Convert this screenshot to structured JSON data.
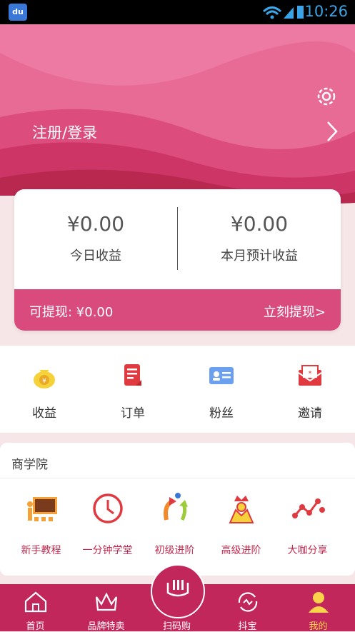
{
  "status_bar": {
    "time": "10:26",
    "app_icon_text": "du"
  },
  "header": {
    "login_label": "注册/登录"
  },
  "earnings": {
    "today_value": "¥0.00",
    "today_label": "今日收益",
    "month_value": "¥0.00",
    "month_label": "本月预计收益",
    "withdrawable_label": "可提现: ¥0.00",
    "withdraw_action": "立刻提现>"
  },
  "quick_menu": [
    {
      "label": "收益",
      "icon": "money-bag-icon"
    },
    {
      "label": "订单",
      "icon": "order-list-icon"
    },
    {
      "label": "粉丝",
      "icon": "fans-card-icon"
    },
    {
      "label": "邀请",
      "icon": "invite-envelope-icon"
    }
  ],
  "school": {
    "title": "商学院",
    "items": [
      {
        "label": "新手教程",
        "icon": "teacher-board-icon"
      },
      {
        "label": "一分钟学堂",
        "icon": "clock-icon"
      },
      {
        "label": "初级进阶",
        "icon": "progress-arrows-icon"
      },
      {
        "label": "高级进阶",
        "icon": "crown-person-icon"
      },
      {
        "label": "大咖分享",
        "icon": "share-nodes-icon"
      }
    ]
  },
  "tabbar": [
    {
      "label": "首页",
      "icon": "home-icon"
    },
    {
      "label": "品牌特卖",
      "icon": "crown-icon"
    },
    {
      "label": "扫码购",
      "icon": "scan-icon"
    },
    {
      "label": "抖宝",
      "icon": "refresh-icon"
    },
    {
      "label": "我的",
      "icon": "user-icon"
    }
  ],
  "colors": {
    "brand_pink": "#e8598a",
    "tab_bg": "#c2275c",
    "active_tab": "#fbd34a"
  }
}
